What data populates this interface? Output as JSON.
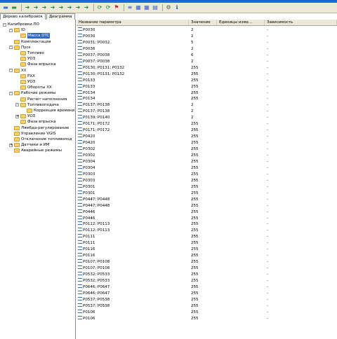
{
  "toolbar": {
    "buttons": [
      "save-icon",
      "open-icon",
      "arrow-right-icon",
      "arrow-right-icon",
      "arrow-right-icon",
      "arrow-right-icon",
      "arrow-right-icon",
      "arrow-right-icon",
      "arrow-right-icon",
      "arrow-right-icon",
      "refresh-icon",
      "refresh-icon",
      "flag-icon",
      "list-icon",
      "grid-icon",
      "grid-icon",
      "chart-icon",
      "gear-icon",
      "info-icon"
    ],
    "glyphs": [
      "▬",
      "▬",
      "➜",
      "➜",
      "➜",
      "➜",
      "➜",
      "➜",
      "➜",
      "➜",
      "⟳",
      "⟳",
      "⚑",
      "≡",
      "▦",
      "▦",
      "▤",
      "⚙",
      "ℹ"
    ],
    "colors": [
      "#3a6fd8",
      "#2f8f3a",
      "#1e8a2a",
      "#1e8a2a",
      "#1e8a2a",
      "#1e8a2a",
      "#1e8a2a",
      "#1e8a2a",
      "#1e8a2a",
      "#1e8a2a",
      "#1e8a2a",
      "#1e8a2a",
      "#c03030",
      "#3a60c8",
      "#3a60c8",
      "#3a60c8",
      "#3a60c8",
      "#555555",
      "#2050c0"
    ]
  },
  "tabs": [
    {
      "label": "Дерево калибровок",
      "active": true
    },
    {
      "label": "Диаграмма",
      "active": false
    }
  ],
  "tree": [
    {
      "label": "Калибровки ПО",
      "exp": "-",
      "level": 0,
      "folder": false
    },
    {
      "label": "ID",
      "exp": "-",
      "level": 1,
      "folder": true
    },
    {
      "label": "Масса DTC",
      "exp": "",
      "level": 2,
      "folder": true,
      "selected": true
    },
    {
      "label": "Комплектация",
      "exp": "",
      "level": 1,
      "folder": true
    },
    {
      "label": "Пуск",
      "exp": "-",
      "level": 1,
      "folder": true
    },
    {
      "label": "Топливо",
      "exp": "",
      "level": 2,
      "folder": true
    },
    {
      "label": "УОЗ",
      "exp": "",
      "level": 2,
      "folder": true
    },
    {
      "label": "Фаза впрыска",
      "exp": "",
      "level": 2,
      "folder": true
    },
    {
      "label": "XX",
      "exp": "-",
      "level": 1,
      "folder": true
    },
    {
      "label": "РXX",
      "exp": "",
      "level": 2,
      "folder": true
    },
    {
      "label": "УОЗ",
      "exp": "",
      "level": 2,
      "folder": true
    },
    {
      "label": "Обороты XX",
      "exp": "",
      "level": 2,
      "folder": true
    },
    {
      "label": "Рабочие режимы",
      "exp": "-",
      "level": 1,
      "folder": true
    },
    {
      "label": "Расчет наполнения",
      "exp": "",
      "level": 2,
      "folder": true
    },
    {
      "label": "Топливоподача",
      "exp": "-",
      "level": 2,
      "folder": true
    },
    {
      "label": "Коррекция времени",
      "exp": "",
      "level": 3,
      "folder": true
    },
    {
      "label": "УОЗ",
      "exp": "+",
      "level": 2,
      "folder": true
    },
    {
      "label": "Фаза впрыска",
      "exp": "",
      "level": 2,
      "folder": true
    },
    {
      "label": "Лямбда-регулирование",
      "exp": "",
      "level": 1,
      "folder": true
    },
    {
      "label": "Управление VGIS",
      "exp": "",
      "level": 1,
      "folder": true
    },
    {
      "label": "Отключение топливопод",
      "exp": "",
      "level": 1,
      "folder": true
    },
    {
      "label": "Датчики и ИМ",
      "exp": "+",
      "level": 1,
      "folder": true
    },
    {
      "label": "Аварийные режимы",
      "exp": "",
      "level": 1,
      "folder": true
    }
  ],
  "grid": {
    "headers": [
      "Название параметра",
      "Значение",
      "Единицы изме...",
      "Зависимость"
    ],
    "rows": [
      [
        "P0030",
        "2",
        "",
        "-"
      ],
      [
        "P0030",
        "2",
        "",
        "-"
      ],
      [
        "P0031; P0032",
        "5",
        "",
        "-"
      ],
      [
        "P0036",
        "2",
        "",
        "-"
      ],
      [
        "P0037; P0038",
        "6",
        "",
        "-"
      ],
      [
        "P0037; P0038",
        "2",
        "",
        "-"
      ],
      [
        "P0130; P0131; P0132",
        "255",
        "",
        "-"
      ],
      [
        "P0130; P0131; P0132",
        "255",
        "",
        "-"
      ],
      [
        "P0133",
        "255",
        "",
        "-"
      ],
      [
        "P0133",
        "255",
        "",
        "-"
      ],
      [
        "P0134",
        "255",
        "",
        "-"
      ],
      [
        "P0134",
        "255",
        "",
        "-"
      ],
      [
        "P0137; P0138",
        "2",
        "",
        "-"
      ],
      [
        "P0137; P0138",
        "2",
        "",
        "-"
      ],
      [
        "P0139; P0140",
        "2",
        "",
        "-"
      ],
      [
        "P0171; P0172",
        "255",
        "",
        "-"
      ],
      [
        "P0171; P0172",
        "255",
        "",
        "-"
      ],
      [
        "P0420",
        "255",
        "",
        "-"
      ],
      [
        "P0420",
        "255",
        "",
        "-"
      ],
      [
        "P0302",
        "255",
        "",
        "-"
      ],
      [
        "P0302",
        "255",
        "",
        "-"
      ],
      [
        "P0304",
        "255",
        "",
        "-"
      ],
      [
        "P0304",
        "255",
        "",
        "-"
      ],
      [
        "P0303",
        "255",
        "",
        "-"
      ],
      [
        "P0303",
        "255",
        "",
        "-"
      ],
      [
        "P0301",
        "255",
        "",
        "-"
      ],
      [
        "P0301",
        "255",
        "",
        "-"
      ],
      [
        "P0447; P0448",
        "255",
        "",
        "-"
      ],
      [
        "P0447; P0448",
        "255",
        "",
        "-"
      ],
      [
        "P0446",
        "255",
        "",
        "-"
      ],
      [
        "P0446",
        "255",
        "",
        "-"
      ],
      [
        "P0112; P0113",
        "255",
        "",
        "-"
      ],
      [
        "P0112; P0113",
        "255",
        "",
        "-"
      ],
      [
        "P0111",
        "255",
        "",
        "-"
      ],
      [
        "P0111",
        "255",
        "",
        "-"
      ],
      [
        "P0116",
        "255",
        "",
        "-"
      ],
      [
        "P0116",
        "255",
        "",
        "-"
      ],
      [
        "P0107; P0108",
        "255",
        "",
        "-"
      ],
      [
        "P0107; P0108",
        "255",
        "",
        "-"
      ],
      [
        "P0532; P0533",
        "255",
        "",
        "-"
      ],
      [
        "P0532; P0533",
        "255",
        "",
        "-"
      ],
      [
        "P0646; P0647",
        "255",
        "",
        "-"
      ],
      [
        "P0646; P0647",
        "255",
        "",
        "-"
      ],
      [
        "P0537; P0538",
        "255",
        "",
        "-"
      ],
      [
        "P0537; P0538",
        "255",
        "",
        "-"
      ],
      [
        "P0106",
        "255",
        "",
        "-"
      ],
      [
        "P0106",
        "255",
        "",
        "-"
      ]
    ]
  }
}
